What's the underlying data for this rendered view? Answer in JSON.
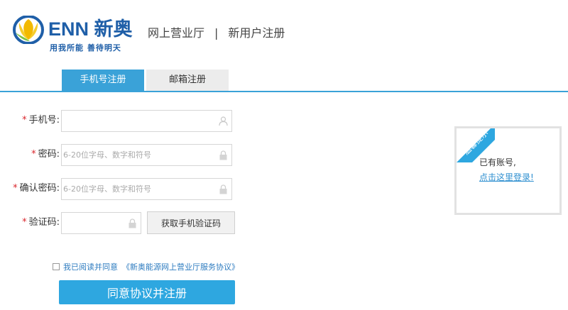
{
  "brand": {
    "name": "ENN 新奥",
    "slogan": "用我所能 善待明天",
    "colors": {
      "primary": "#1f5fa8",
      "accent": "#3aa2d8",
      "petal": "#f2b900",
      "button": "#2ea7e0"
    }
  },
  "header": {
    "portal": "网上营业厅",
    "separator": "|",
    "page": "新用户注册"
  },
  "tabs": [
    {
      "label": "手机号注册",
      "active": true
    },
    {
      "label": "邮箱注册",
      "active": false
    }
  ],
  "form": {
    "required_mark": "*",
    "phone": {
      "label": "手机号:",
      "value": "",
      "icon": "user-icon"
    },
    "password": {
      "label": "密码:",
      "placeholder": "6-20位字母、数字和符号",
      "icon": "lock-icon"
    },
    "confirm": {
      "label": "确认密码:",
      "placeholder": "6-20位字母、数字和符号",
      "icon": "lock-icon"
    },
    "code": {
      "label": "验证码:",
      "value": "",
      "icon": "lock-icon",
      "button": "获取手机验证码"
    }
  },
  "agreement": {
    "text": "我已阅读并同意",
    "link": "《新奥能源网上营业厅服务协议》",
    "checked": false
  },
  "submit": "同意协议并注册",
  "tips": {
    "ribbon": "温馨提示",
    "have_account": "已有账号,",
    "login_link": "点击这里登录!"
  }
}
